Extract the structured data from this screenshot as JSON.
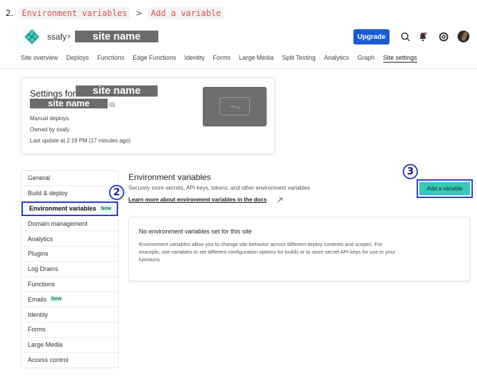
{
  "step": {
    "number": "2.",
    "path": [
      "Environment variables",
      "Add a variable"
    ],
    "separator": ">"
  },
  "topbar": {
    "team": "ssafy",
    "team_separator": "›",
    "site_name": "site name",
    "upgrade_label": "Upgrade",
    "icons": [
      "search-icon",
      "notifications-icon",
      "help-icon",
      "user-avatar"
    ]
  },
  "nav": {
    "items": [
      "Site overview",
      "Deploys",
      "Functions",
      "Edge Functions",
      "Identity",
      "Forms",
      "Large Media",
      "Split Testing",
      "Analytics",
      "Graph",
      "Site settings"
    ],
    "active": "Site settings"
  },
  "settings_card": {
    "title": "Settings for",
    "site_name": "site name",
    "site_name_2": "site name",
    "app_suffix": "pp",
    "lines": [
      "Manual deploys.",
      "Owned by ssafy.",
      "Last update at 2:19 PM (17 minutes ago)"
    ]
  },
  "sidebar": {
    "items": [
      {
        "label": "General",
        "badge": ""
      },
      {
        "label": "Build & deploy",
        "badge": ""
      },
      {
        "label": "Environment variables",
        "badge": "New"
      },
      {
        "label": "Domain management",
        "badge": ""
      },
      {
        "label": "Analytics",
        "badge": ""
      },
      {
        "label": "Plugins",
        "badge": ""
      },
      {
        "label": "Log Drains",
        "badge": ""
      },
      {
        "label": "Functions",
        "badge": ""
      },
      {
        "label": "Emails",
        "badge": "New"
      },
      {
        "label": "Identity",
        "badge": ""
      },
      {
        "label": "Forms",
        "badge": ""
      },
      {
        "label": "Large Media",
        "badge": ""
      },
      {
        "label": "Access control",
        "badge": ""
      }
    ],
    "selected_index": 2
  },
  "main": {
    "title": "Environment variables",
    "description": "Securely store secrets, API keys, tokens, and other environment variables",
    "docs_link": "Learn more about environment variables in the docs",
    "add_button": "Add a variable",
    "empty_title": "No environment variables set for this site",
    "empty_desc": "Environment variables allow you to change site behavior across different deploy contexts and scopes. For example, use variables to set different configuration options for builds or to store secret API keys for use in your functions."
  },
  "annotations": {
    "circle_sidebar": "2",
    "circle_button": "3",
    "highlight_color": "#2f3fd1"
  },
  "colors": {
    "accent": "#1a5cd6",
    "add_button": "#37c9b6",
    "code_text": "#d9534f"
  }
}
